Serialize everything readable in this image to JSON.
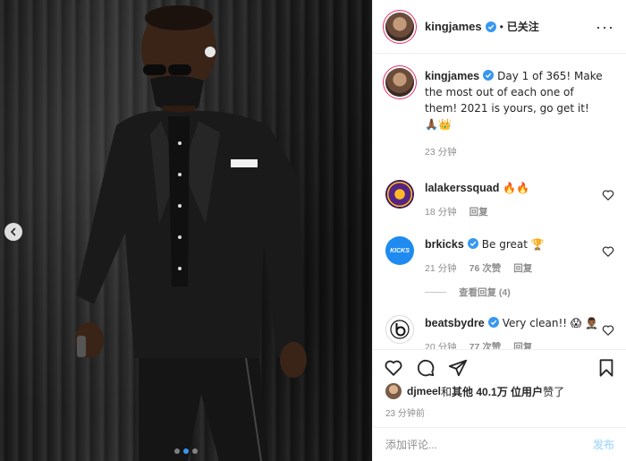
{
  "header": {
    "username": "kingjames",
    "separator": "•",
    "follow_label": "已关注",
    "more_label": "···"
  },
  "caption": {
    "username": "kingjames",
    "text": "Day 1 of 365! Make the most out of each one of them! 2021 is yours, go get it! 🙏🏾👑",
    "time": "23 分钟"
  },
  "comments": [
    {
      "username": "lalakerssquad",
      "text": "🔥🔥",
      "time": "18 分钟",
      "reply_label": "回复"
    },
    {
      "username": "brkicks",
      "text": "Be great 🏆",
      "time": "21 分钟",
      "likes": "76 次赞",
      "reply_label": "回复",
      "view_replies": "查看回复 (4)"
    },
    {
      "username": "beatsbydre",
      "text": "Very clean!! 😱 🤵🏾‍♂️",
      "time": "20 分钟",
      "likes": "77 次赞",
      "reply_label": "回复"
    }
  ],
  "avatars": {
    "brkicks_text": "KICKS"
  },
  "likes": {
    "liker": "djmeel",
    "and": " 和 ",
    "others": "其他 40.1万 位用户",
    "suffix": " 赞了"
  },
  "timestamp": "23 分钟前",
  "add_comment": {
    "placeholder": "添加评论...",
    "post_label": "发布"
  },
  "carousel": {
    "current_index": 1,
    "count": 3
  },
  "colors": {
    "verified": "#3897f0",
    "link_disabled": "#b2dffc",
    "muted": "#8e8e8e"
  }
}
